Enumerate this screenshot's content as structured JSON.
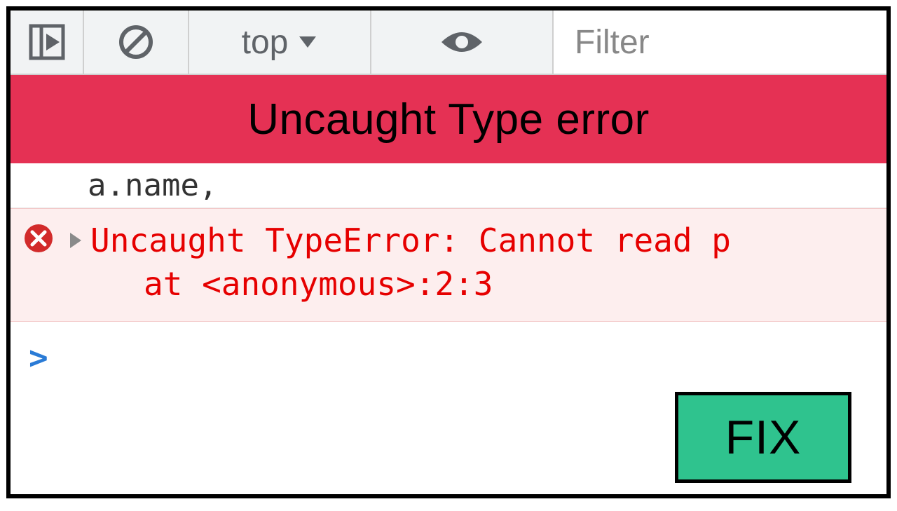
{
  "toolbar": {
    "context_label": "top",
    "filter_placeholder": "Filter"
  },
  "banner": {
    "title": "Uncaught Type error"
  },
  "code": {
    "partial_line": "a.name,"
  },
  "error": {
    "line1": "Uncaught TypeError: Cannot read p",
    "line2": "at <anonymous>:2:3"
  },
  "prompt": {
    "symbol": ">"
  },
  "fix": {
    "label": "FIX"
  }
}
